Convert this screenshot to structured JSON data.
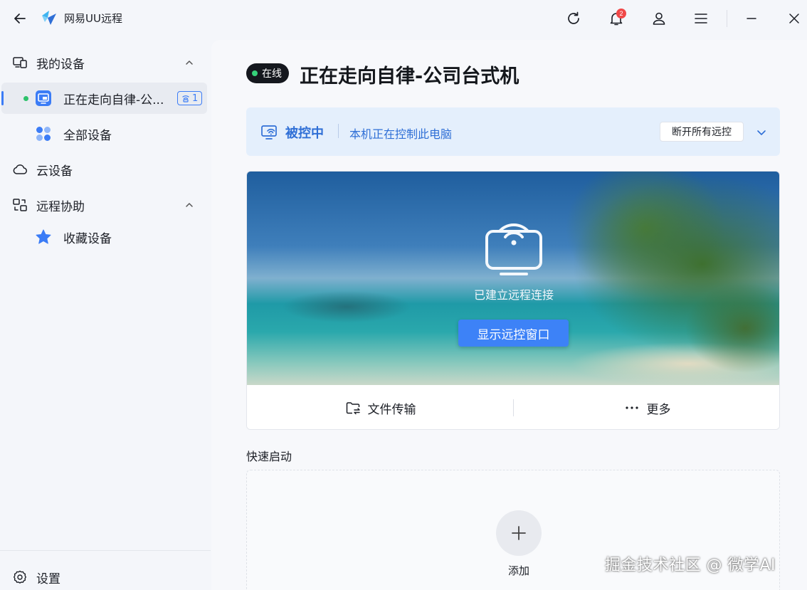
{
  "app": {
    "title": "网易UU远程"
  },
  "titlebar": {
    "notification_count": "2"
  },
  "sidebar": {
    "my_devices": "我的设备",
    "current_device": "正在走向自律-公...",
    "current_device_count": "1",
    "all_devices": "全部设备",
    "cloud_devices": "云设备",
    "remote_assist": "远程协助",
    "favorite_devices": "收藏设备",
    "settings": "设置"
  },
  "main": {
    "status_pill": "在线",
    "device_title": "正在走向自律-公司台式机",
    "banner": {
      "state": "被控中",
      "description": "本机正在控制此电脑",
      "disconnect_label": "断开所有远控"
    },
    "preview": {
      "connection_text": "已建立远程连接",
      "show_window_label": "显示远控窗口"
    },
    "actions": {
      "file_transfer": "文件传输",
      "more": "更多"
    },
    "quick_start": {
      "title": "快速启动",
      "add_label": "添加"
    }
  },
  "watermark": "掘金技术社区 @ 微学AI",
  "colors": {
    "accent": "#3d82f7",
    "online": "#2dc26b",
    "banner_bg": "#e4effc",
    "banner_text": "#2f6fd6",
    "badge": "#f04848"
  },
  "icons": [
    "back-arrow-icon",
    "uu-logo-icon",
    "refresh-icon",
    "bell-icon",
    "user-icon",
    "menu-icon",
    "minimize-icon",
    "close-icon",
    "devices-icon",
    "chevron-up-icon",
    "monitor-icon",
    "grid-dots-icon",
    "cloud-icon",
    "remote-assist-icon",
    "star-icon",
    "gear-icon",
    "remote-control-icon",
    "chevron-down-icon",
    "wifi-screen-icon",
    "folder-transfer-icon",
    "ellipsis-icon",
    "plus-icon"
  ]
}
